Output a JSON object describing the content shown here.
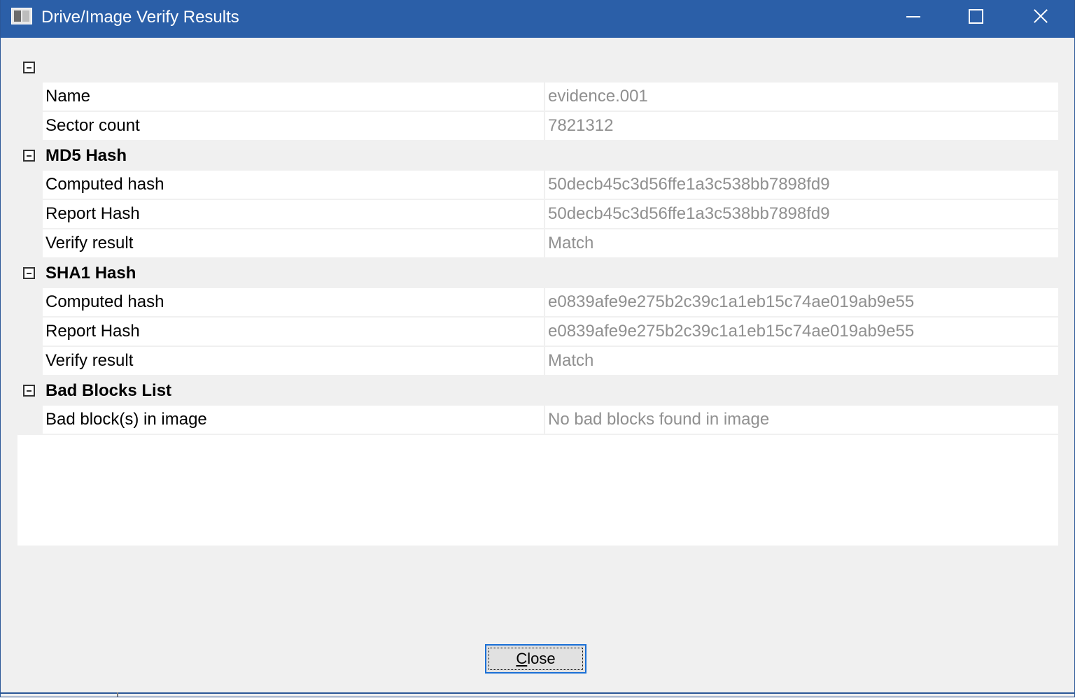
{
  "window": {
    "title": "Drive/Image Verify Results"
  },
  "grid": {
    "rows": [
      {
        "kind": "category",
        "label": ""
      },
      {
        "kind": "property",
        "name": "Name",
        "value": "evidence.001"
      },
      {
        "kind": "property",
        "name": "Sector count",
        "value": "7821312"
      },
      {
        "kind": "category",
        "label": "MD5 Hash"
      },
      {
        "kind": "property",
        "name": "Computed hash",
        "value": "50decb45c3d56ffe1a3c538bb7898fd9"
      },
      {
        "kind": "property",
        "name": "Report Hash",
        "value": "50decb45c3d56ffe1a3c538bb7898fd9"
      },
      {
        "kind": "property",
        "name": "Verify result",
        "value": "Match"
      },
      {
        "kind": "category",
        "label": "SHA1 Hash"
      },
      {
        "kind": "property",
        "name": "Computed hash",
        "value": "e0839afe9e275b2c39c1a1eb15c74ae019ab9e55"
      },
      {
        "kind": "property",
        "name": "Report Hash",
        "value": "e0839afe9e275b2c39c1a1eb15c74ae019ab9e55"
      },
      {
        "kind": "property",
        "name": "Verify result",
        "value": "Match"
      },
      {
        "kind": "category",
        "label": "Bad Blocks List"
      },
      {
        "kind": "property",
        "name": "Bad block(s) in image",
        "value": "No bad blocks found in image"
      }
    ]
  },
  "buttons": {
    "close_label_mnemonic": "C",
    "close_label_rest": "lose"
  },
  "icons": {
    "app": "window-app-icon",
    "minimize": "minimize-icon",
    "maximize": "maximize-icon",
    "close": "close-icon",
    "expander": "collapse-minus-icon"
  },
  "colors": {
    "titlebar": "#2b5fa8",
    "value_text": "#909090",
    "focus_border": "#1a6fd6"
  }
}
